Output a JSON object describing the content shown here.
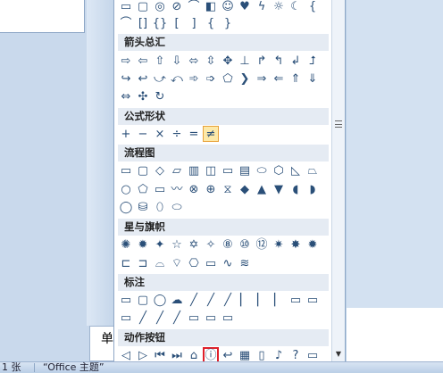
{
  "sections": [
    {
      "title": "",
      "rows": [
        {
          "icons": [
            [
              "rect-icon",
              "▭"
            ],
            [
              "rect-icon",
              "▢"
            ],
            [
              "circle-icon",
              "◎"
            ],
            [
              "no-symbol-icon",
              "⊘"
            ],
            [
              "arc-icon",
              "⌒"
            ],
            [
              "folded-corner-icon",
              "◧"
            ],
            [
              "smiley-icon",
              "☺"
            ],
            [
              "heart-icon",
              "♥"
            ],
            [
              "lightning-icon",
              "ϟ"
            ],
            [
              "sun-icon",
              "☼"
            ],
            [
              "moon-icon",
              "☾"
            ],
            [
              "brace-icon",
              "{"
            ]
          ]
        },
        {
          "icons": [
            [
              "arc-icon",
              "⌒"
            ],
            [
              "bracket-pair-icon",
              "[]"
            ],
            [
              "brace-pair-icon",
              "{}"
            ],
            [
              "left-bracket-icon",
              "["
            ],
            [
              "right-bracket-icon",
              "]"
            ],
            [
              "left-brace-icon",
              "{"
            ],
            [
              "right-brace-icon",
              "}"
            ]
          ]
        }
      ]
    },
    {
      "title": "箭头总汇",
      "rows": [
        {
          "icons": [
            [
              "arrow-right-icon",
              "⇨"
            ],
            [
              "arrow-left-icon",
              "⇦"
            ],
            [
              "arrow-up-icon",
              "⇧"
            ],
            [
              "arrow-down-icon",
              "⇩"
            ],
            [
              "arrow-left-right-icon",
              "⬄"
            ],
            [
              "arrow-up-down-icon",
              "⇳"
            ],
            [
              "arrow-quad-icon",
              "✥"
            ],
            [
              "arrow-left-right-up-icon",
              "⊥"
            ],
            [
              "arrow-bent-icon",
              "↱"
            ],
            [
              "arrow-u-turn-icon",
              "↰"
            ],
            [
              "arrow-left-up-icon",
              "↲"
            ],
            [
              "arrow-bent-up-icon",
              "⮥"
            ]
          ]
        },
        {
          "icons": [
            [
              "arrow-curved-right-icon",
              "↪"
            ],
            [
              "arrow-curved-left-icon",
              "↩"
            ],
            [
              "arrow-curved-up-icon",
              "⤻"
            ],
            [
              "arrow-curved-down-icon",
              "⤺"
            ],
            [
              "arrow-striped-right-icon",
              "➾"
            ],
            [
              "arrow-notched-right-icon",
              "➩"
            ],
            [
              "pentagon-arrow-icon",
              "⬠"
            ],
            [
              "chevron-arrow-icon",
              "❯"
            ],
            [
              "callout-arrow-right-icon",
              "⇒"
            ],
            [
              "callout-arrow-left-icon",
              "⇐"
            ],
            [
              "callout-arrow-up-icon",
              "⇑"
            ],
            [
              "callout-arrow-down-icon",
              "⇓"
            ]
          ]
        },
        {
          "icons": [
            [
              "callout-arrow-left-right-icon",
              "⇔"
            ],
            [
              "callout-arrow-quad-icon",
              "✣"
            ],
            [
              "circular-arrow-icon",
              "↻"
            ]
          ]
        }
      ]
    },
    {
      "title": "公式形状",
      "rows": [
        {
          "icons": [
            [
              "plus-icon",
              "+"
            ],
            [
              "minus-icon",
              "−"
            ],
            [
              "multiply-icon",
              "×"
            ],
            [
              "divide-icon",
              "÷"
            ],
            [
              "equal-icon",
              "="
            ],
            [
              "not-equal-icon",
              "≠"
            ]
          ]
        }
      ]
    },
    {
      "title": "流程图",
      "rows": [
        {
          "icons": [
            [
              "flow-process-icon",
              "▭"
            ],
            [
              "flow-alt-process-icon",
              "▢"
            ],
            [
              "flow-decision-icon",
              "◇"
            ],
            [
              "flow-data-icon",
              "▱"
            ],
            [
              "flow-predefined-icon",
              "▥"
            ],
            [
              "flow-internal-storage-icon",
              "◫"
            ],
            [
              "flow-document-icon",
              "▭"
            ],
            [
              "flow-multidocument-icon",
              "▤"
            ],
            [
              "flow-terminator-icon",
              "⬭"
            ],
            [
              "flow-preparation-icon",
              "⬡"
            ],
            [
              "flow-manual-input-icon",
              "◺"
            ],
            [
              "flow-manual-operation-icon",
              "⏢"
            ]
          ]
        },
        {
          "icons": [
            [
              "flow-connector-icon",
              "○"
            ],
            [
              "flow-offpage-icon",
              "⬠"
            ],
            [
              "flow-card-icon",
              "▭"
            ],
            [
              "flow-punched-tape-icon",
              "〰"
            ],
            [
              "flow-summing-junction-icon",
              "⊗"
            ],
            [
              "flow-or-icon",
              "⊕"
            ],
            [
              "flow-collate-icon",
              "⧖"
            ],
            [
              "flow-sort-icon",
              "◆"
            ],
            [
              "flow-extract-icon",
              "▲"
            ],
            [
              "flow-merge-icon",
              "▼"
            ],
            [
              "flow-stored-data-icon",
              "◖"
            ],
            [
              "flow-delay-icon",
              "◗"
            ]
          ]
        },
        {
          "icons": [
            [
              "flow-sequential-storage-icon",
              "◯"
            ],
            [
              "flow-magnetic-disk-icon",
              "⛁"
            ],
            [
              "flow-direct-storage-icon",
              "⬯"
            ],
            [
              "flow-display-icon",
              "⬭"
            ]
          ]
        }
      ]
    },
    {
      "title": "星与旗帜",
      "rows": [
        {
          "icons": [
            [
              "explosion-1-icon",
              "✺"
            ],
            [
              "explosion-2-icon",
              "✹"
            ],
            [
              "star-4-icon",
              "✦"
            ],
            [
              "star-5-icon",
              "☆"
            ],
            [
              "star-6-icon",
              "✡"
            ],
            [
              "star-7-icon",
              "✧"
            ],
            [
              "star-8-icon",
              "⑧"
            ],
            [
              "star-10-icon",
              "⑩"
            ],
            [
              "star-12-icon",
              "⑫"
            ],
            [
              "star-16-icon",
              "✷"
            ],
            [
              "star-24-icon",
              "✸"
            ],
            [
              "star-32-icon",
              "✹"
            ]
          ]
        },
        {
          "icons": [
            [
              "ribbon-up-icon",
              "⊏"
            ],
            [
              "ribbon-down-icon",
              "⊐"
            ],
            [
              "curved-ribbon-up-icon",
              "⌓"
            ],
            [
              "curved-ribbon-down-icon",
              "⌔"
            ],
            [
              "scroll-vertical-icon",
              "⎔"
            ],
            [
              "scroll-horizontal-icon",
              "▭"
            ],
            [
              "wave-icon",
              "∿"
            ],
            [
              "double-wave-icon",
              "≋"
            ]
          ]
        }
      ]
    },
    {
      "title": "标注",
      "rows": [
        {
          "icons": [
            [
              "callout-rect-icon",
              "▭"
            ],
            [
              "callout-rounded-rect-icon",
              "▢"
            ],
            [
              "callout-oval-icon",
              "◯"
            ],
            [
              "callout-cloud-icon",
              "☁"
            ],
            [
              "callout-line-1-icon",
              "╱"
            ],
            [
              "callout-line-2-icon",
              "╱"
            ],
            [
              "callout-line-3-icon",
              "╱"
            ],
            [
              "callout-accent-1-icon",
              "▏"
            ],
            [
              "callout-accent-2-icon",
              "▏"
            ],
            [
              "callout-accent-3-icon",
              "▏"
            ],
            [
              "callout-border-1-icon",
              "▭"
            ],
            [
              "callout-border-2-icon",
              "▭"
            ]
          ]
        },
        {
          "icons": [
            [
              "callout-border-3-icon",
              "▭"
            ],
            [
              "callout-noborder-1-icon",
              "╱"
            ],
            [
              "callout-noborder-2-icon",
              "╱"
            ],
            [
              "callout-noborder-3-icon",
              "╱"
            ],
            [
              "callout-accent-border-1-icon",
              "▭"
            ],
            [
              "callout-accent-border-2-icon",
              "▭"
            ],
            [
              "callout-accent-border-3-icon",
              "▭"
            ]
          ]
        }
      ]
    },
    {
      "title": "动作按钮",
      "rows": [
        {
          "icons": [
            [
              "action-back-icon",
              "◁"
            ],
            [
              "action-forward-icon",
              "▷"
            ],
            [
              "action-beginning-icon",
              "⏮"
            ],
            [
              "action-end-icon",
              "⏭"
            ],
            [
              "action-home-icon",
              "⌂"
            ],
            [
              "action-information-icon",
              "ⓘ"
            ],
            [
              "action-return-icon",
              "↩"
            ],
            [
              "action-movie-icon",
              "▦"
            ],
            [
              "action-document-icon",
              "▯"
            ],
            [
              "action-sound-icon",
              "♪"
            ],
            [
              "action-help-icon",
              "?"
            ],
            [
              "action-custom-icon",
              "▭"
            ]
          ]
        }
      ]
    }
  ],
  "selected_shape": "not-equal-icon",
  "highlighted_shape": "action-information-icon",
  "slide_panel_label": "单",
  "status": {
    "slides": "1 张",
    "theme": "“Office 主题”"
  }
}
